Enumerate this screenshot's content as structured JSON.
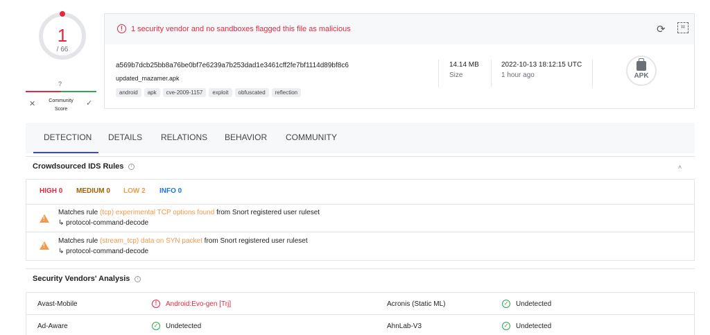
{
  "score": {
    "detections": "1",
    "total": "/ 66",
    "community_question": "?",
    "community_label": "Community Score"
  },
  "header": {
    "alert": "1 security vendor and no sandboxes flagged this file as malicious",
    "hash": "a569b7dcb25bb8a76be0bf7e6239a7b253dad1e3461cff2fe7bf1114d89bf8c6",
    "filename": "updated_mazamer.apk",
    "tags": [
      "android",
      "apk",
      "cve-2009-1157",
      "exploit",
      "obfuscated",
      "reflection"
    ],
    "size_value": "14.14 MB",
    "size_label": "Size",
    "date_value": "2022-10-13 18:12:15 UTC",
    "date_label": "1 hour ago",
    "filetype": "APK"
  },
  "tabs": [
    "DETECTION",
    "DETAILS",
    "RELATIONS",
    "BEHAVIOR",
    "COMMUNITY"
  ],
  "ids": {
    "title": "Crowdsourced IDS Rules",
    "counts": {
      "high": "HIGH 0",
      "medium": "MEDIUM 0",
      "low": "LOW 2",
      "info": "INFO 0"
    },
    "rules": [
      {
        "prefix": "Matches rule ",
        "rule": "(tcp) experimental TCP options found",
        "suffix": " from Snort registered user ruleset",
        "sub": "↳ protocol-command-decode"
      },
      {
        "prefix": "Matches rule ",
        "rule": "(stream_tcp) data on SYN packet",
        "suffix": " from Snort registered user ruleset",
        "sub": "↳ protocol-command-decode"
      }
    ]
  },
  "vendors": {
    "title": "Security Vendors' Analysis",
    "rows": [
      {
        "left_name": "Avast-Mobile",
        "left_result": "Android:Evo-gen [Trj]",
        "right_name": "Acronis (Static ML)",
        "right_result": "Undetected"
      },
      {
        "left_name": "Ad-Aware",
        "left_result": "Undetected",
        "right_name": "AhnLab-V3",
        "right_result": "Undetected"
      }
    ]
  },
  "colors": {
    "danger": "#e3273f",
    "ok": "#2fa84f",
    "warning": "#f2994a",
    "info": "#1a73e8",
    "accent": "#3046e6"
  }
}
